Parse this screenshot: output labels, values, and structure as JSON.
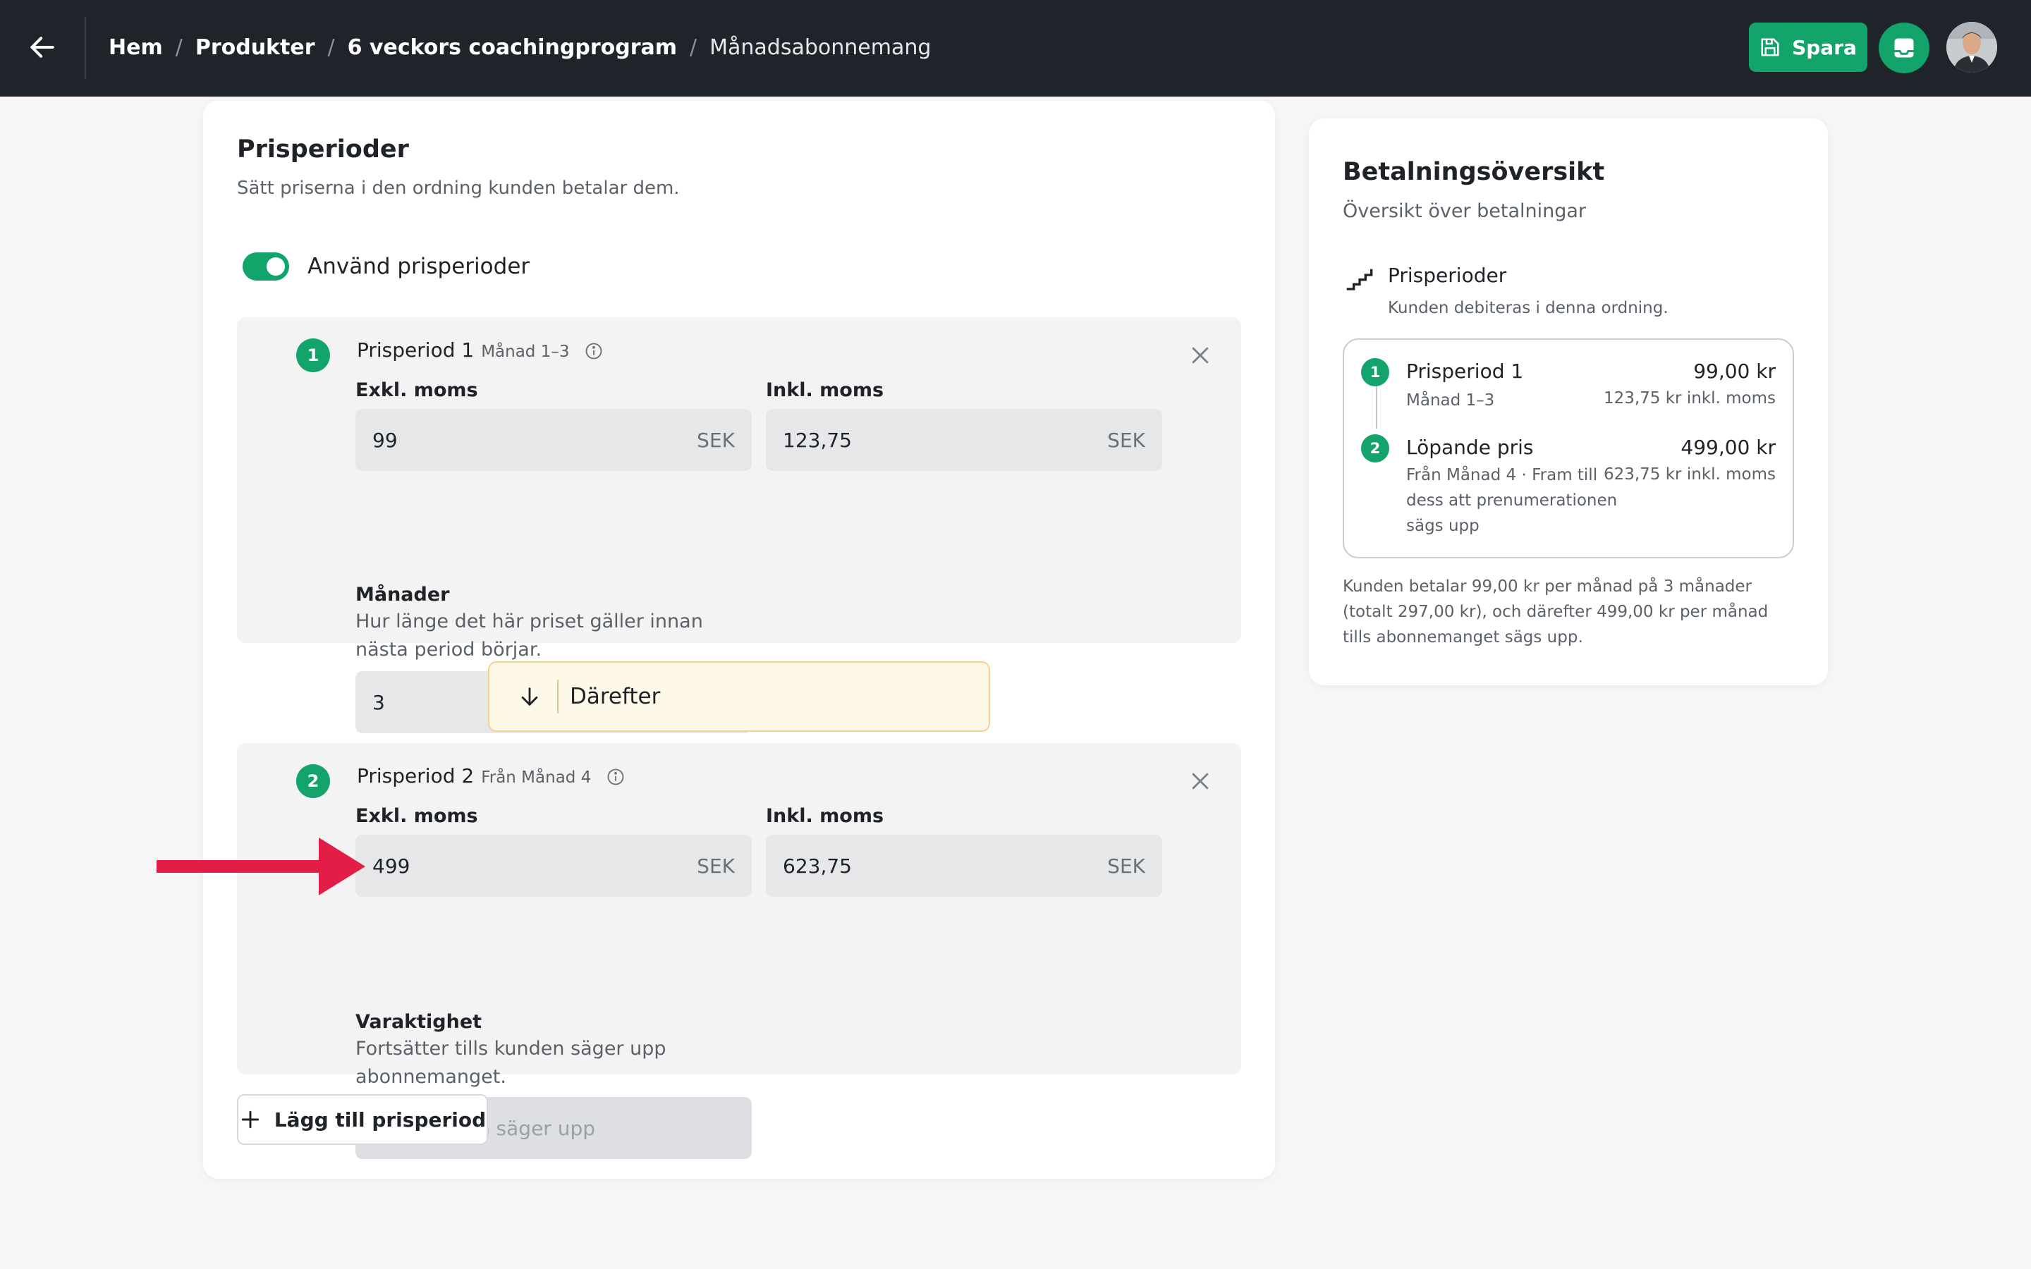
{
  "header": {
    "breadcrumb": [
      "Hem",
      "Produkter",
      "6 veckors coachingprogram"
    ],
    "breadcrumb_current": "Månadsabonnemang",
    "save_label": "Spara",
    "icons": {
      "back": "arrow-left-icon",
      "save": "floppy-disk-icon",
      "inbox": "inbox-icon"
    },
    "accent_color": "#12a46a"
  },
  "prices": {
    "title": "Prisperioder",
    "subtitle": "Sätt priserna i den ordning kunden betalar dem.",
    "toggle_label": "Använd prisperioder",
    "toggle_on": true,
    "periods": [
      {
        "number": "1",
        "title": "Prisperiod 1",
        "subtitle": "Månad 1–3",
        "excl_label": "Exkl. moms",
        "excl_value": "99",
        "incl_label": "Inkl. moms",
        "incl_value": "123,75",
        "currency": "SEK",
        "months_label": "Månader",
        "months_help": "Hur länge det här priset gäller innan nästa period börjar.",
        "months_value": "3"
      },
      {
        "number": "2",
        "title": "Prisperiod 2",
        "subtitle": "Från Månad 4",
        "excl_label": "Exkl. moms",
        "excl_value": "499",
        "incl_label": "Inkl. moms",
        "incl_value": "623,75",
        "currency": "SEK",
        "duration_label": "Varaktighet",
        "duration_help": "Fortsätter tills kunden säger upp abonnemanget.",
        "duration_placeholder": "Tills kunden säger upp"
      }
    ],
    "therefore_label": "Därefter",
    "add_label": "Lägg till prisperiod"
  },
  "overview": {
    "title": "Betalningsöversikt",
    "subtitle": "Översikt över betalningar",
    "section_title": "Prisperioder",
    "section_subtitle": "Kunden debiteras i denna ordning.",
    "items": [
      {
        "number": "1",
        "name": "Prisperiod 1",
        "meta": "Månad 1–3",
        "price": "99,00 kr",
        "incl": "123,75 kr inkl. moms"
      },
      {
        "number": "2",
        "name": "Löpande pris",
        "meta": "Från Månad 4 · Fram till dess att prenumerationen sägs upp",
        "price": "499,00 kr",
        "incl": "623,75 kr inkl. moms"
      }
    ],
    "footer": "Kunden betalar 99,00 kr per månad på 3 månader (totalt 297,00 kr), och därefter 499,00 kr per månad tills abonnemanget sägs upp."
  }
}
